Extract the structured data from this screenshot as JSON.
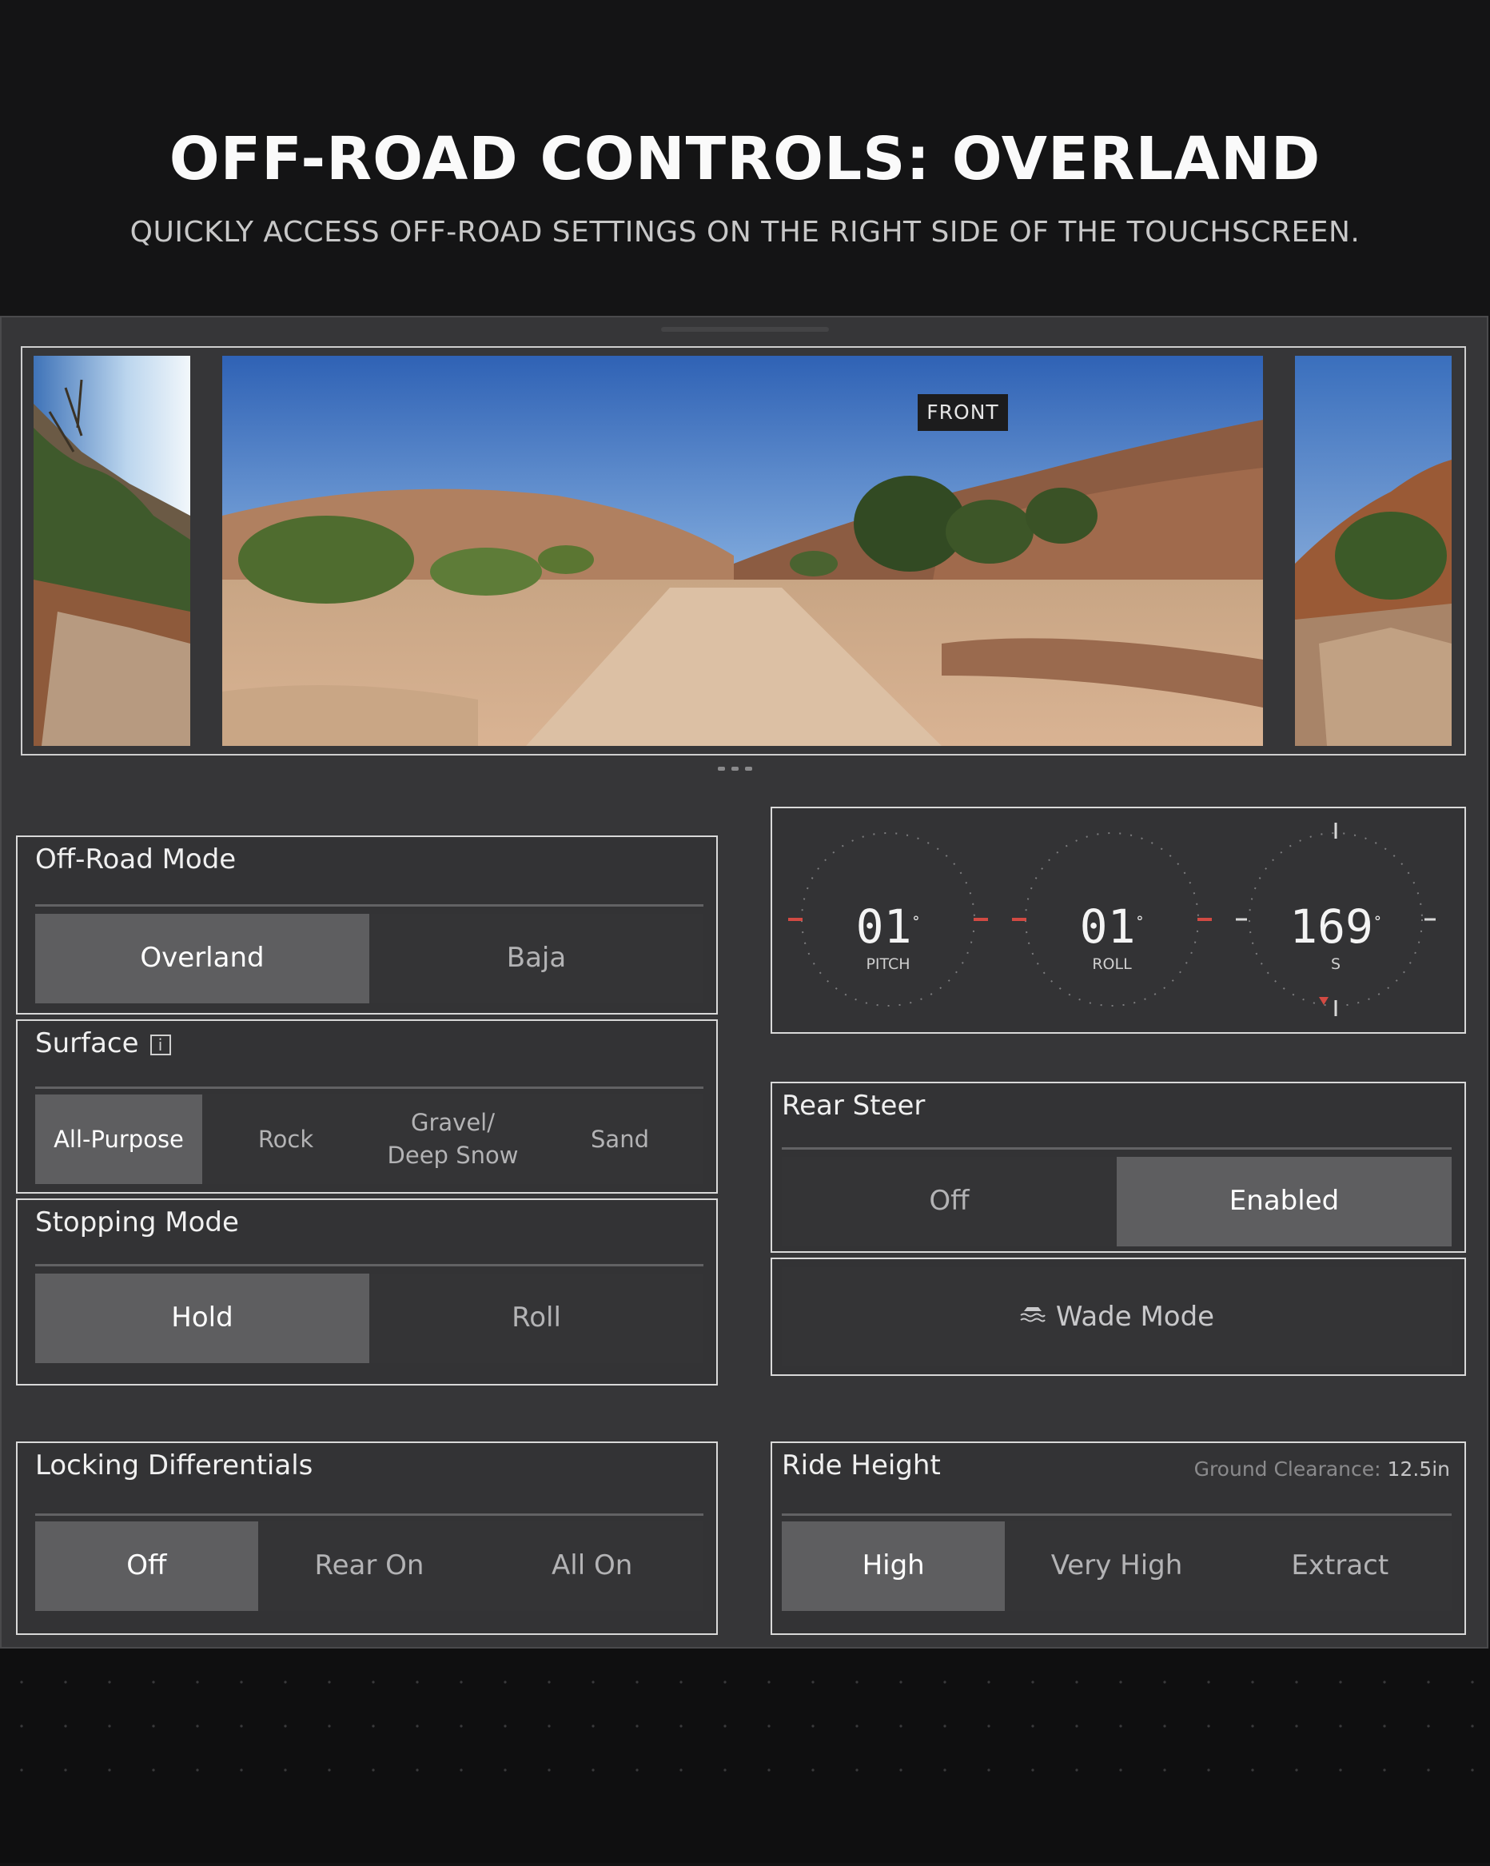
{
  "header": {
    "title": "OFF-ROAD CONTROLS: OVERLAND",
    "subtitle": "QUICKLY ACCESS OFF-ROAD SETTINGS ON THE RIGHT SIDE OF THE TOUCHSCREEN."
  },
  "camera": {
    "front_label": "FRONT"
  },
  "off_road_mode": {
    "title": "Off-Road Mode",
    "options": [
      "Overland",
      "Baja"
    ],
    "selected": "Overland"
  },
  "surface": {
    "title": "Surface",
    "info_icon": "i",
    "options": [
      "All-Purpose",
      "Rock",
      "Gravel/",
      "Deep Snow",
      "Sand"
    ],
    "selected": "All-Purpose"
  },
  "stopping_mode": {
    "title": "Stopping Mode",
    "options": [
      "Hold",
      "Roll"
    ],
    "selected": "Hold"
  },
  "locking_differentials": {
    "title": "Locking Differentials",
    "options": [
      "Off",
      "Rear On",
      "All On"
    ],
    "selected": "Off"
  },
  "gauges": {
    "pitch": {
      "value": "01",
      "label": "PITCH",
      "unit": "°"
    },
    "roll": {
      "value": "01",
      "label": "ROLL",
      "unit": "°"
    },
    "heading": {
      "value": "169",
      "label": "S",
      "unit": "°"
    }
  },
  "rear_steer": {
    "title": "Rear Steer",
    "options": [
      "Off",
      "Enabled"
    ],
    "selected": "Enabled"
  },
  "wade_mode": {
    "label": "Wade Mode",
    "icon": "wave-car-icon"
  },
  "ride_height": {
    "title": "Ride Height",
    "ground_label": "Ground Clearance:",
    "ground_value": "12.5in",
    "options": [
      "High",
      "Very High",
      "Extract"
    ],
    "selected": "High"
  },
  "colors": {
    "background": "#131314",
    "panel": "#363638",
    "selected": "#5e5e60",
    "accent_red": "#d24a43"
  }
}
